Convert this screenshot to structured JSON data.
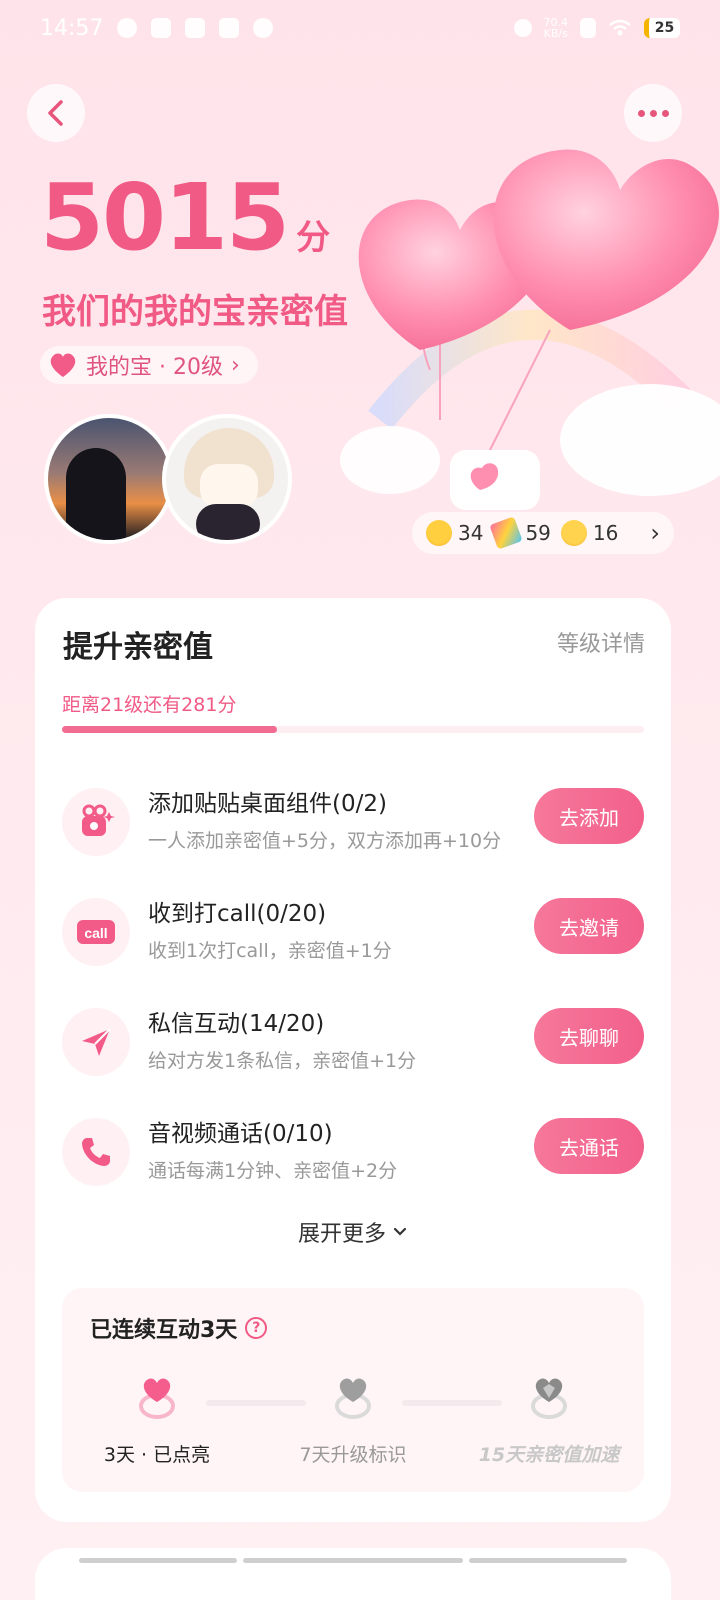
{
  "status_bar": {
    "time": "14:57",
    "net_speed": "70.4",
    "net_unit": "KB/s",
    "battery": "25"
  },
  "hero": {
    "score": "5015",
    "score_unit": "分",
    "title": "我们的我的宝亲密值",
    "level_label": "我的宝 · 20级",
    "level_chevron": "›",
    "emoji_stats": [
      {
        "icon": "hug-emoji",
        "count": "34"
      },
      {
        "icon": "party-popper-emoji",
        "count": "59"
      },
      {
        "icon": "smirk-emoji",
        "count": "16"
      }
    ],
    "emoji_chevron": "›"
  },
  "card": {
    "title": "提升亲密值",
    "level_detail_link": "等级详情",
    "progress_text": "距离21级还有281分",
    "progress_fraction": 0.37,
    "tasks": [
      {
        "icon": "widget-icon",
        "title": "添加贴贴桌面组件(0/2)",
        "desc": "一人添加亲密值+5分，双方添加再+10分",
        "button": "去添加"
      },
      {
        "icon": "call-icon",
        "title": "收到打call(0/20)",
        "desc": "收到1次打call，亲密值+1分",
        "button": "去邀请"
      },
      {
        "icon": "send-icon",
        "title": "私信互动(14/20)",
        "desc": "给对方发1条私信，亲密值+1分",
        "button": "去聊聊"
      },
      {
        "icon": "phone-icon",
        "title": "音视频通话(0/10)",
        "desc": "通话每满1分钟、亲密值+2分",
        "button": "去通话"
      }
    ],
    "expand_label": "展开更多",
    "streak": {
      "title": "已连续互动3天",
      "help": "?",
      "milestones": [
        {
          "label": "3天 · 已点亮",
          "state": "lit"
        },
        {
          "label": "7天升级标识",
          "state": "locked"
        },
        {
          "label": "15天亲密值加速",
          "state": "locked"
        }
      ]
    }
  },
  "colors": {
    "accent": "#f05a85",
    "button": "#f2608b",
    "background": "#ffe3ea"
  }
}
